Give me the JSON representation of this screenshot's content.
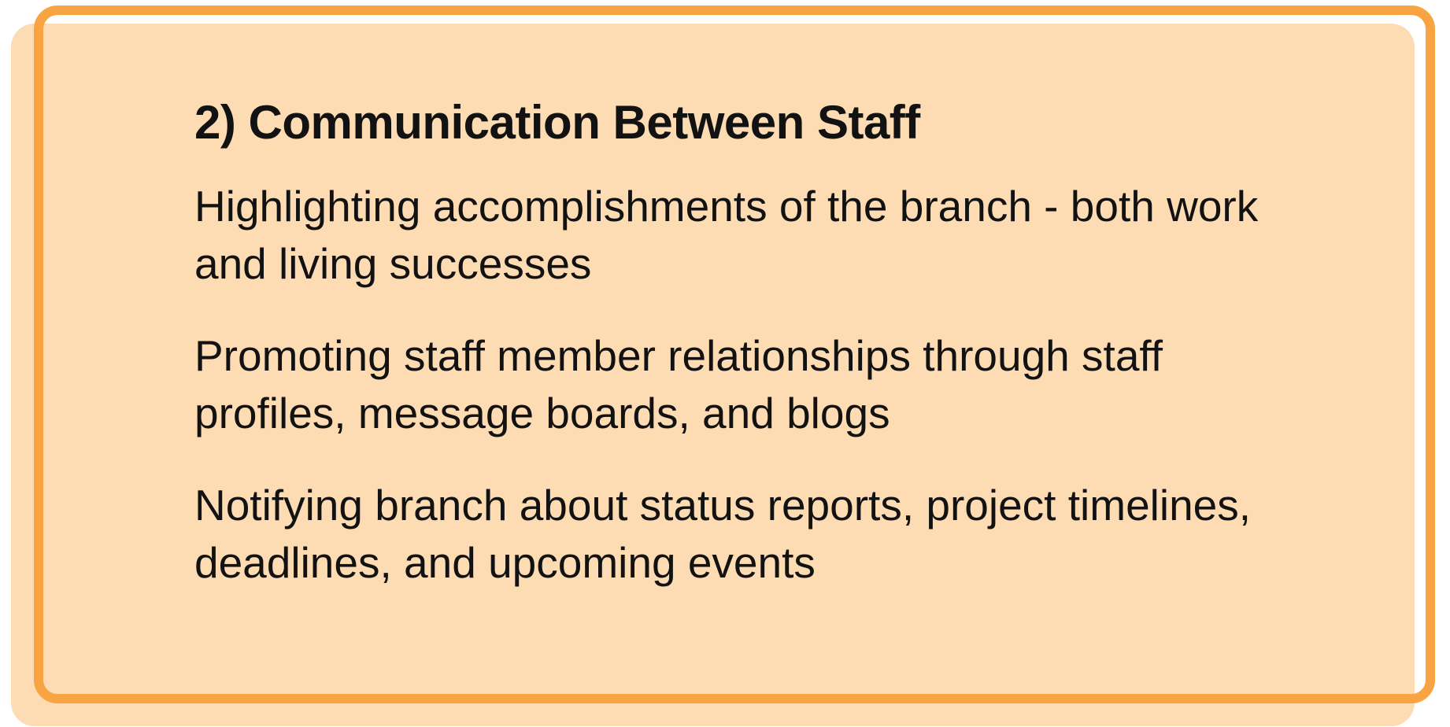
{
  "card": {
    "title": "2) Communication Between Staff",
    "paragraphs": [
      "Highlighting accomplishments of the branch - both work and living successes",
      "Promoting staff member relationships through staff profiles, message boards, and blogs",
      "Notifying branch about status reports, project timelines, deadlines, and upcoming events"
    ]
  },
  "colors": {
    "frame": "#f9a443",
    "fill": "#fddbb3",
    "text": "#121212"
  }
}
